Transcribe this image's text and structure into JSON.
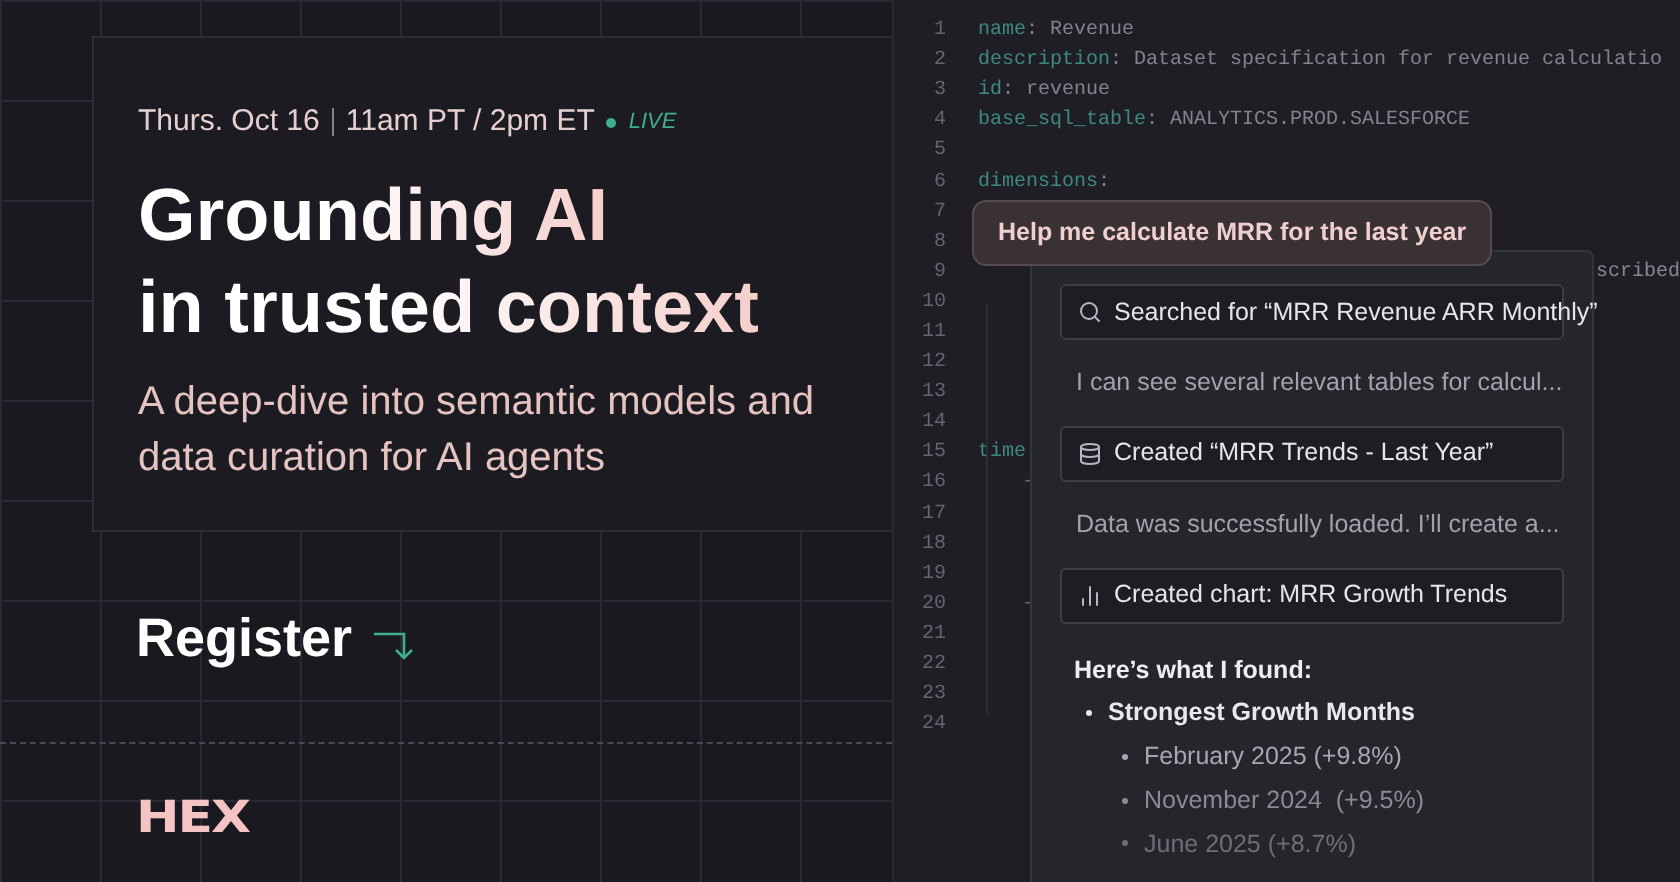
{
  "event": {
    "date": "Thurs. Oct 16",
    "time": "11am PT / 2pm ET",
    "live": "LIVE"
  },
  "title_lines": [
    "Grounding AI",
    "in trusted context"
  ],
  "subtitle": "A deep-dive into semantic models and data curation for AI agents",
  "register": "Register",
  "logo": "HEX",
  "editor": {
    "lines": [
      {
        "number": "1",
        "kind": "kv",
        "key": "name",
        "rest": ": Revenue"
      },
      {
        "number": "2",
        "kind": "kv",
        "key": "description",
        "rest": ": Dataset specification for revenue calculatio"
      },
      {
        "number": "3",
        "kind": "kv",
        "key": "id",
        "rest": ": revenue"
      },
      {
        "number": "4",
        "kind": "kv",
        "key": "base_sql_table",
        "rest": ": ANALYTICS.PROD.SALESFORCE"
      },
      {
        "number": "5",
        "kind": "blank"
      },
      {
        "number": "6",
        "kind": "kv",
        "key": "dimensions",
        "rest": ":"
      },
      {
        "number": "7",
        "kind": "blank"
      },
      {
        "number": "8",
        "kind": "blank"
      },
      {
        "number": "9",
        "kind": "tail",
        "rest": "scribed"
      },
      {
        "number": "10",
        "kind": "blank"
      },
      {
        "number": "11",
        "kind": "blank"
      },
      {
        "number": "12",
        "kind": "blank"
      },
      {
        "number": "13",
        "kind": "blank"
      },
      {
        "number": "14",
        "kind": "blank"
      },
      {
        "number": "15",
        "kind": "kv",
        "key": "time"
      },
      {
        "number": "16",
        "kind": "dash",
        "rest": "-"
      },
      {
        "number": "17",
        "kind": "blank"
      },
      {
        "number": "18",
        "kind": "blank"
      },
      {
        "number": "19",
        "kind": "blank"
      },
      {
        "number": "20",
        "kind": "dash",
        "rest": "-"
      },
      {
        "number": "21",
        "kind": "blank"
      },
      {
        "number": "22",
        "kind": "blank"
      },
      {
        "number": "23",
        "kind": "blank"
      },
      {
        "number": "24",
        "kind": "blank"
      }
    ]
  },
  "chat": {
    "prompt": "Help me calculate MRR for the last year",
    "steps": [
      {
        "kind": "search",
        "text": "Searched for “MRR Revenue ARR Monthly”"
      },
      {
        "kind": "message",
        "text": "I can see several relevant tables for calcul..."
      },
      {
        "kind": "dataset",
        "text": "Created “MRR Trends - Last Year”"
      },
      {
        "kind": "message",
        "text": "Data was successfully loaded. I’ll create a..."
      },
      {
        "kind": "chart",
        "text": "Created chart: MRR Growth Trends"
      }
    ],
    "answer": {
      "heading": "Here’s what I found:",
      "items": [
        {
          "text": "Strongest Growth Months",
          "children": [
            {
              "text": "February 2025 (+9.8%)"
            },
            {
              "text": "November 2024  (+9.5%)"
            },
            {
              "text": "June 2025 (+8.7%)"
            }
          ]
        }
      ]
    }
  }
}
